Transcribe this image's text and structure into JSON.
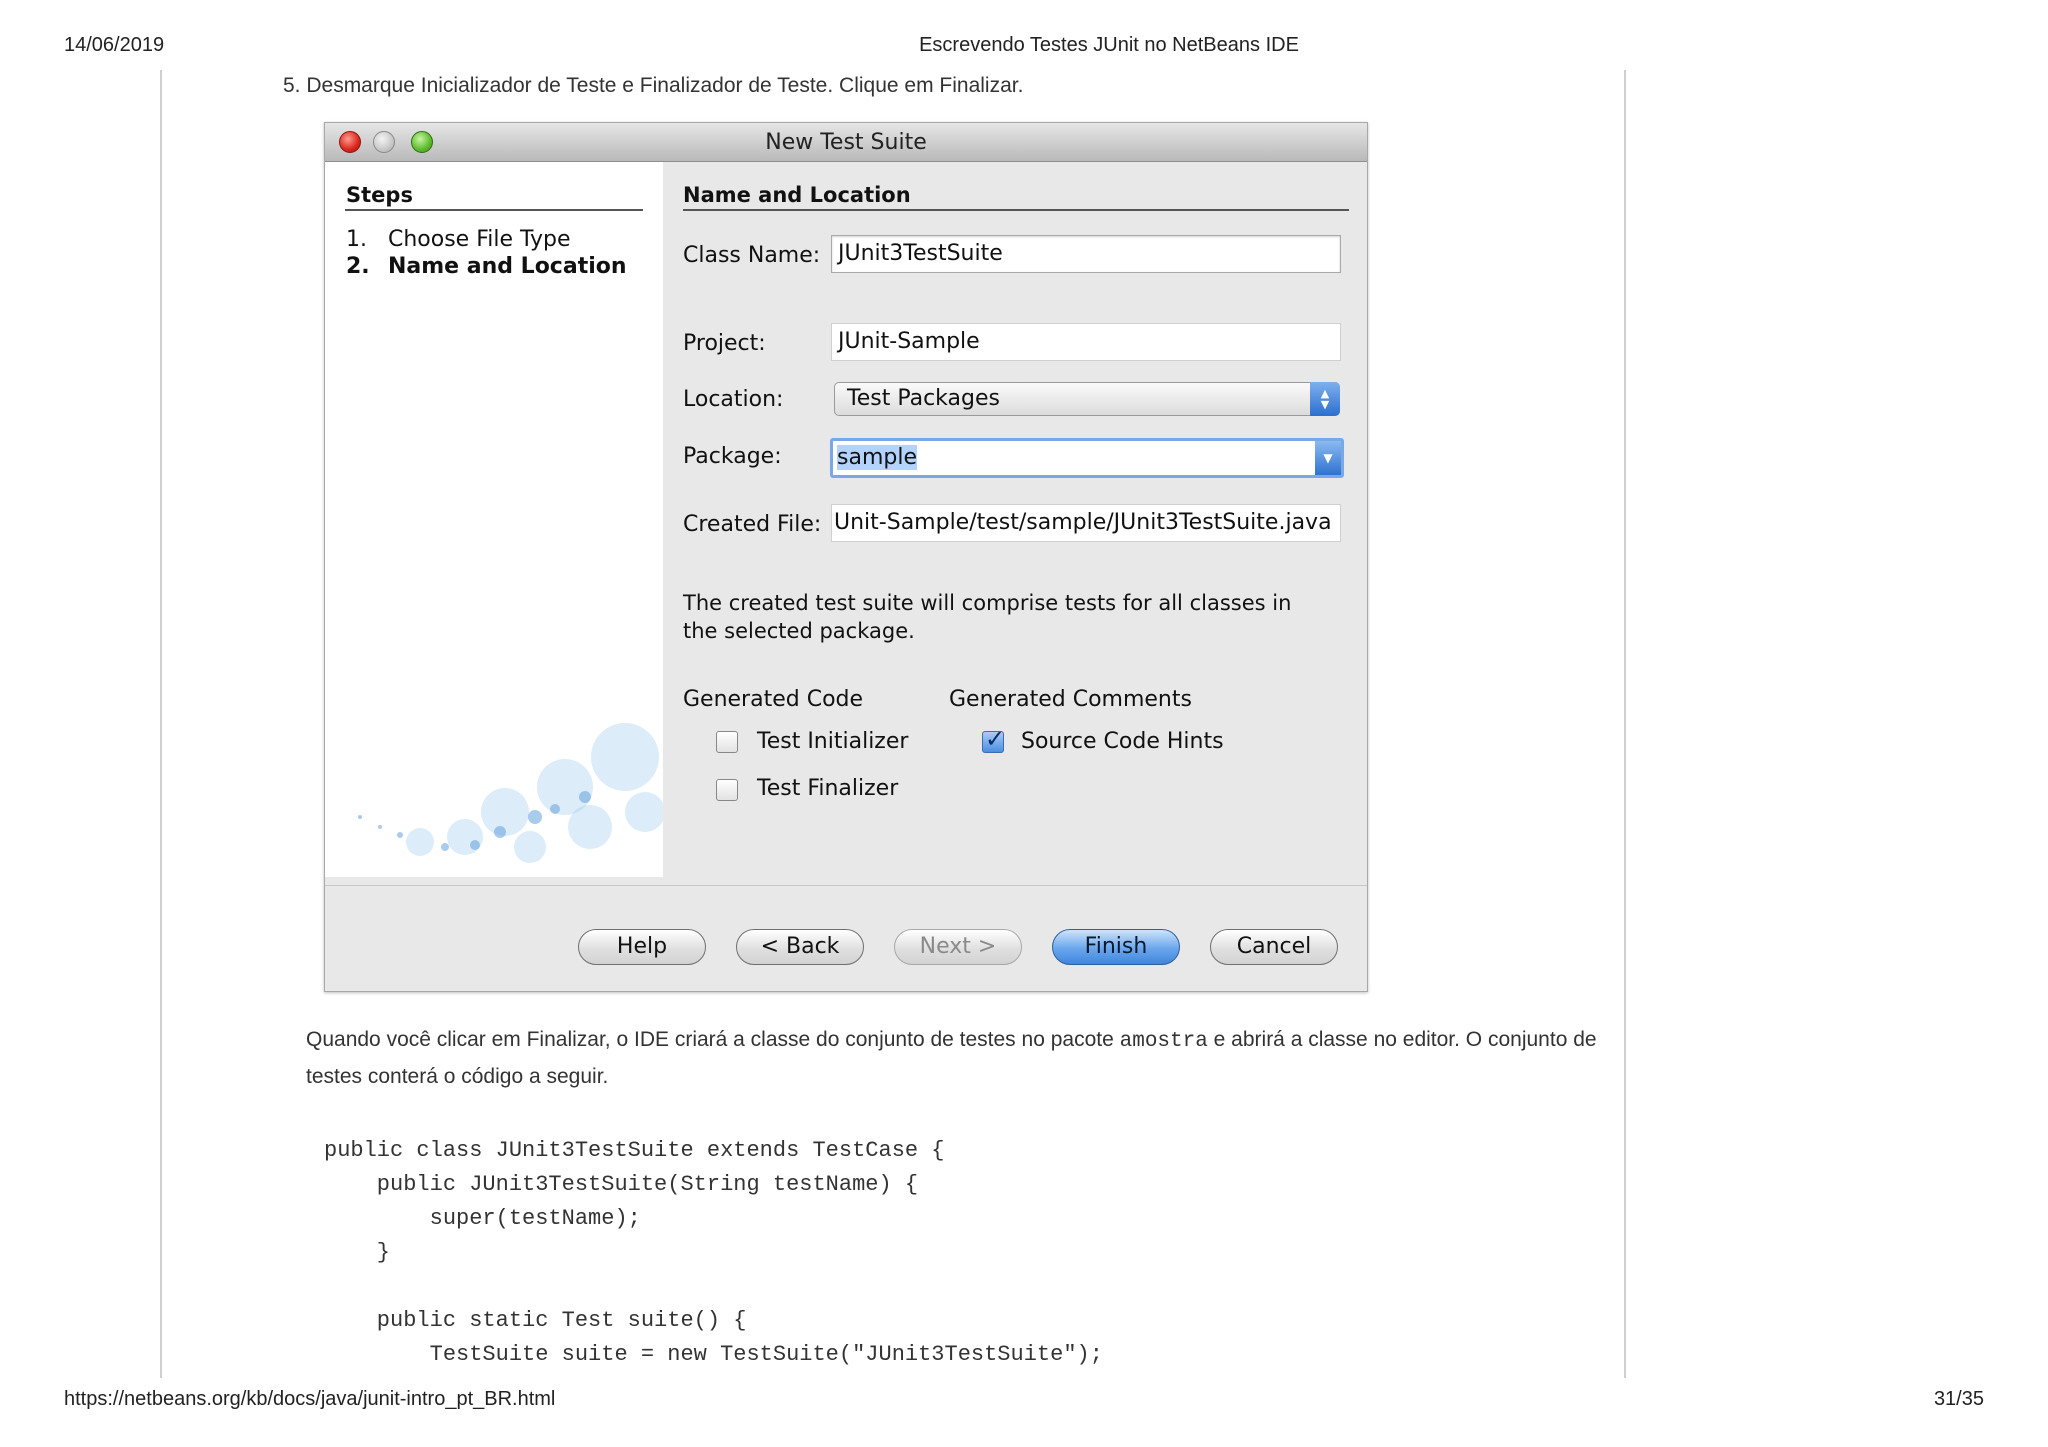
{
  "page": {
    "date": "14/06/2019",
    "doc_title": "Escrevendo Testes JUnit no NetBeans IDE",
    "url": "https://netbeans.org/kb/docs/java/junit-intro_pt_BR.html",
    "page_number": "31/35"
  },
  "instruction": "5. Desmarque Inicializador de Teste e Finalizador de Teste. Clique em Finalizar.",
  "dialog": {
    "title": "New Test Suite",
    "steps": {
      "heading": "Steps",
      "items": [
        {
          "num": "1.",
          "label": "Choose File Type",
          "current": false
        },
        {
          "num": "2.",
          "label": "Name and Location",
          "current": true
        }
      ]
    },
    "section_heading": "Name and Location",
    "class_name": {
      "label": "Class Name:",
      "value": "JUnit3TestSuite"
    },
    "project": {
      "label": "Project:",
      "value": "JUnit-Sample"
    },
    "location": {
      "label": "Location:",
      "value": "Test Packages"
    },
    "package": {
      "label": "Package:",
      "value": "sample"
    },
    "created_file": {
      "label": "Created File:",
      "value": "Unit-Sample/test/sample/JUnit3TestSuite.java"
    },
    "description": "The created test suite will comprise tests for all classes in the selected package.",
    "generated_code": {
      "heading": "Generated Code",
      "test_initializer": {
        "label": "Test Initializer",
        "checked": false
      },
      "test_finalizer": {
        "label": "Test Finalizer",
        "checked": false
      }
    },
    "generated_comments": {
      "heading": "Generated Comments",
      "source_code_hints": {
        "label": "Source Code Hints",
        "checked": true
      }
    },
    "buttons": {
      "help": "Help",
      "back": "< Back",
      "next": "Next >",
      "finish": "Finish",
      "cancel": "Cancel"
    }
  },
  "paragraph": {
    "part1": "Quando você clicar em Finalizar, o IDE criará a classe do conjunto de testes no pacote ",
    "code": "amostra",
    "part2": " e abrirá a classe no editor. O conjunto de testes conterá o código a seguir."
  },
  "code_lines": [
    "public class JUnit3TestSuite extends TestCase {",
    "    public JUnit3TestSuite(String testName) {",
    "        super(testName);",
    "    }",
    "",
    "    public static Test suite() {",
    "        TestSuite suite = new TestSuite(\"JUnit3TestSuite\");"
  ]
}
